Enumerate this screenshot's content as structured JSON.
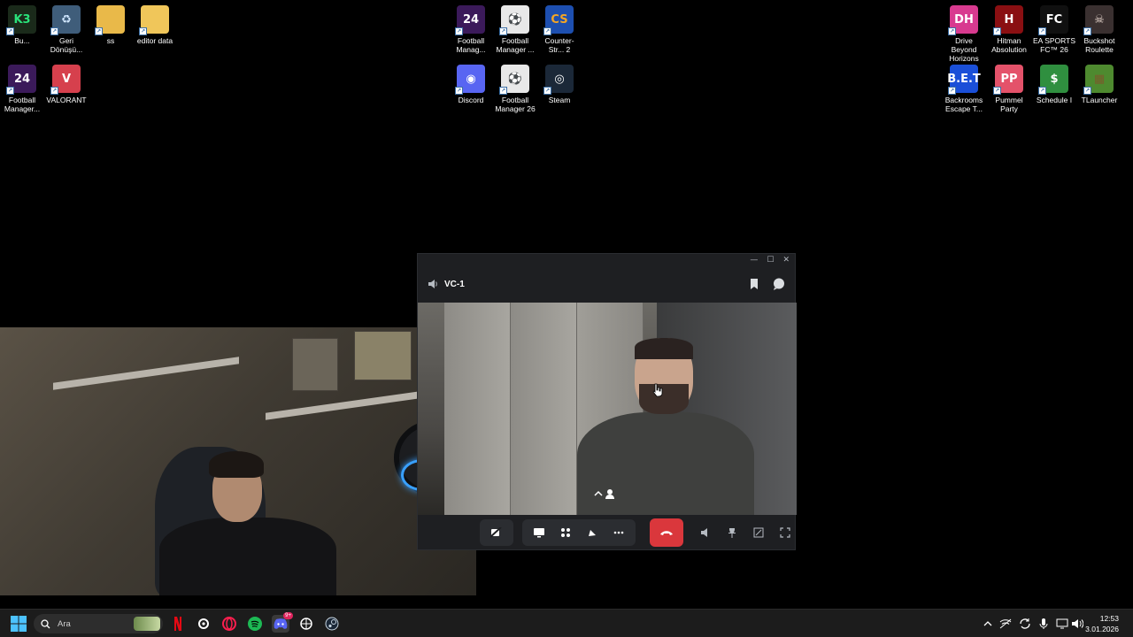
{
  "desktop": {
    "icons": [
      {
        "label": "Bu...",
        "name": "k3-app-icon",
        "glyph": "K3",
        "bg": "#1a2a1a",
        "fg": "#2ae27a",
        "col": 0,
        "row": 0
      },
      {
        "label": "Geri Dönüşü...",
        "name": "recycle-bin-icon",
        "glyph": "♻",
        "bg": "#3f5d7a",
        "fg": "#cfe6ff",
        "col": 1,
        "row": 0
      },
      {
        "label": "ss",
        "name": "folder-icon",
        "glyph": "",
        "bg": "#e9b949",
        "fg": "#000",
        "col": 2,
        "row": 0
      },
      {
        "label": "editor data",
        "name": "folder-icon",
        "glyph": "",
        "bg": "#f0c65a",
        "fg": "#000",
        "col": 3,
        "row": 0
      },
      {
        "label": "Football Manager...",
        "name": "football-manager-24-icon",
        "glyph": "24",
        "bg": "#3b1a5a",
        "fg": "#fff",
        "col": 0,
        "row": 1
      },
      {
        "label": "VALORANT",
        "name": "valorant-icon",
        "glyph": "V",
        "bg": "#d6404d",
        "fg": "#fff",
        "col": 1,
        "row": 1
      }
    ],
    "center_icons": [
      {
        "label": "Football Manag...",
        "name": "football-manager-24-icon",
        "glyph": "24",
        "bg": "#3b1a5a",
        "fg": "#fff"
      },
      {
        "label": "Football Manager ...",
        "name": "football-manager-icon",
        "glyph": "⚽",
        "bg": "#e8e8e8",
        "fg": "#222"
      },
      {
        "label": "Counter-Str... 2",
        "name": "counter-strike-icon",
        "glyph": "CS",
        "bg": "#1d4fb0",
        "fg": "#f5a623"
      },
      {
        "label": "Discord",
        "name": "discord-icon",
        "glyph": "◉",
        "bg": "#5865f2",
        "fg": "#fff"
      },
      {
        "label": "Football Manager 26",
        "name": "football-manager-icon",
        "glyph": "⚽",
        "bg": "#e8e8e8",
        "fg": "#222"
      },
      {
        "label": "Steam",
        "name": "steam-icon",
        "glyph": "◎",
        "bg": "#1b2838",
        "fg": "#fff"
      }
    ],
    "right_icons": [
      {
        "label": "Drive Beyond Horizons",
        "name": "drive-beyond-horizons-icon",
        "glyph": "DH",
        "bg": "#d83a8f",
        "fg": "#fff"
      },
      {
        "label": "Hitman Absolution",
        "name": "hitman-icon",
        "glyph": "H",
        "bg": "#8a0f12",
        "fg": "#fff"
      },
      {
        "label": "EA SPORTS FC™ 26",
        "name": "ea-sports-fc-icon",
        "glyph": "FC",
        "bg": "#101010",
        "fg": "#fff"
      },
      {
        "label": "Buckshot Roulette",
        "name": "buckshot-roulette-icon",
        "glyph": "☠",
        "bg": "#3a3030",
        "fg": "#e0d0c8"
      },
      {
        "label": "Backrooms Escape T...",
        "name": "backrooms-escape-icon",
        "glyph": "B.E.T",
        "bg": "#1a4fd8",
        "fg": "#fff"
      },
      {
        "label": "Pummel Party",
        "name": "pummel-party-icon",
        "glyph": "PP",
        "bg": "#e4526a",
        "fg": "#fff"
      },
      {
        "label": "Schedule I",
        "name": "schedule-one-icon",
        "glyph": "$",
        "bg": "#2f8f3f",
        "fg": "#fff"
      },
      {
        "label": "TLauncher",
        "name": "tlauncher-icon",
        "glyph": "▦",
        "bg": "#4e8a2f",
        "fg": "#7b5a2c"
      }
    ]
  },
  "call": {
    "channel": "VC-1",
    "titlebar": {
      "minimize": "—",
      "maximize": "☐",
      "close": "✕"
    }
  },
  "taskbar": {
    "search_placeholder": "Ara",
    "clock_time": "12:53",
    "clock_date": "3.01.2026",
    "discord_badge": "9+",
    "accent": "#0078d4"
  }
}
